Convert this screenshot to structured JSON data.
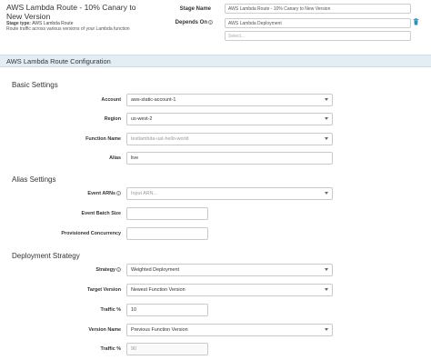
{
  "header": {
    "stage_title": "AWS Lambda Route - 10% Canary to New Version",
    "stage_type_label": "Stage type:",
    "stage_type_value": "AWS Lambda Route",
    "stage_description": "Route traffic across various versions of your Lambda function",
    "stage_name_label": "Stage Name",
    "stage_name_value": "AWS Lambda Route - 10% Canary to New Version",
    "depends_on_label": "Depends On",
    "depends_on_value": "AWS Lambda Deployment",
    "depends_on_placeholder": "Select..."
  },
  "config_bar": {
    "title": "AWS Lambda Route Configuration"
  },
  "basic": {
    "title": "Basic Settings",
    "account_label": "Account",
    "account_value": "aws-static-account-1",
    "region_label": "Region",
    "region_value": "us-west-2",
    "function_name_label": "Function Name",
    "function_name_value": "testlambda-uat-hello-world",
    "alias_label": "Alias",
    "alias_value": "live"
  },
  "alias": {
    "title": "Alias Settings",
    "event_arns_label": "Event ARNs",
    "event_arns_placeholder": "Input ARN...",
    "event_batch_size_label": "Event Batch Size",
    "event_batch_size_value": "",
    "provisioned_concurrency_label": "Provisioned Concurrency",
    "provisioned_concurrency_value": ""
  },
  "deployment": {
    "title": "Deployment Strategy",
    "strategy_label": "Strategy",
    "strategy_value": "Weighted Deployment",
    "target_version_label": "Target Version",
    "target_version_value": "Newest Function Version",
    "traffic1_label": "Traffic %",
    "traffic1_value": "10",
    "version_name_label": "Version Name",
    "version_name_value": "Previous Function Version",
    "traffic2_label": "Traffic %",
    "traffic2_value": "90"
  }
}
